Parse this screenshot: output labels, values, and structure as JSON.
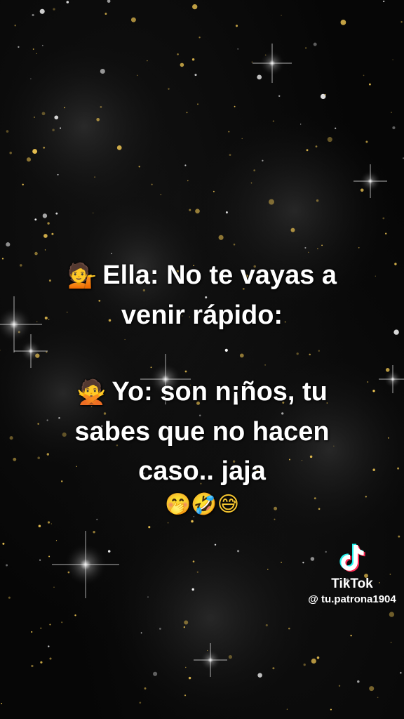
{
  "caption": {
    "ella_emoji": "💁",
    "ella_line1": "Ella: No te vayas a",
    "ella_line2": "venir rápido:",
    "yo_emoji": "🙅",
    "yo_line1": "Yo: son n¡ños, tu",
    "yo_line2": "sabes que no hacen",
    "yo_line3": "caso.. jaja",
    "emoji_row": "🤭🤣😅"
  },
  "watermark": {
    "brand": "TikTok",
    "handle": "@ tu.patrona1904",
    "logo_icon": "tiktok-note-icon"
  },
  "colors": {
    "background": "#060606",
    "text": "#ffffff",
    "glitter": "#e8c050",
    "logo_cyan": "#25f4ee",
    "logo_pink": "#fe2c55"
  }
}
